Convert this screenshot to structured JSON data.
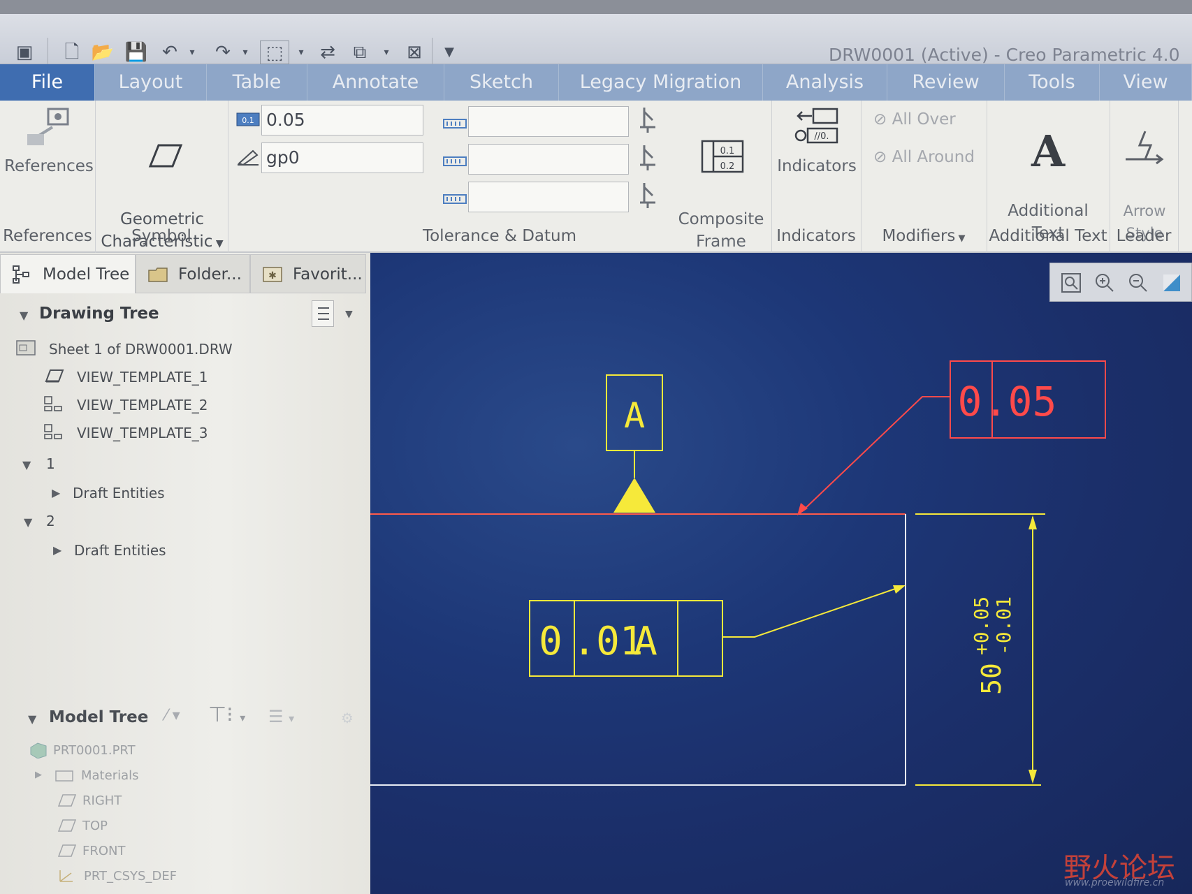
{
  "window": {
    "title": "DRW0001 (Active) - Creo Parametric 4.0"
  },
  "quick_access": {
    "icons": [
      "window-icon",
      "new-icon",
      "open-icon",
      "save-icon",
      "undo-icon",
      "redo-icon",
      "select-box-icon",
      "regenerate-icon",
      "windows-icon",
      "close-icon",
      "customize-icon"
    ]
  },
  "tabs": [
    {
      "label": "File"
    },
    {
      "label": "Layout"
    },
    {
      "label": "Table"
    },
    {
      "label": "Annotate"
    },
    {
      "label": "Sketch"
    },
    {
      "label": "Legacy Migration"
    },
    {
      "label": "Analysis"
    },
    {
      "label": "Review"
    },
    {
      "label": "Tools"
    },
    {
      "label": "View"
    }
  ],
  "ribbon": {
    "references_button": "References",
    "geometric_characteristic": "Geometric\nCharacteristic",
    "tolerance_value": "0.05",
    "name_value": "gp0",
    "datum_fields": [
      "",
      "",
      ""
    ],
    "composite_frame": "Composite\nFrame",
    "indicators_button": "Indicators",
    "all_over": "All Over",
    "all_around": "All Around",
    "additional_text": "Additional\nText",
    "arrow_style": "Arrow\nStyle",
    "groups": {
      "references": "References",
      "symbol": "Symbol",
      "tolerance_datum": "Tolerance & Datum",
      "indicators": "Indicators",
      "modifiers": "Modifiers",
      "additional_text": "Additional Text",
      "leader": "Leader"
    }
  },
  "panel": {
    "tabs": [
      {
        "label": "Model Tree"
      },
      {
        "label": "Folder..."
      },
      {
        "label": "Favorit..."
      }
    ],
    "drawing_tree": {
      "title": "Drawing Tree",
      "rows": [
        "Sheet 1 of DRW0001.DRW",
        "VIEW_TEMPLATE_1",
        "VIEW_TEMPLATE_2",
        "VIEW_TEMPLATE_3",
        "1",
        "Draft Entities",
        "2",
        "Draft Entities"
      ]
    },
    "model_tree": {
      "title": "Model Tree",
      "rows": [
        "PRT0001.PRT",
        "Materials",
        "RIGHT",
        "TOP",
        "FRONT",
        "PRT_CSYS_DEF"
      ]
    }
  },
  "drawing": {
    "datum_label": "A",
    "gtol_selected": {
      "tol_a": "0",
      "tol_b": ".05"
    },
    "gtol_existing": {
      "tol_a": "0",
      "tol_b": ".01",
      "datum": "A"
    },
    "dimension": {
      "nominal": "50",
      "upper": "+0.05",
      "lower": "-0.01"
    },
    "colors": {
      "yellow": "#f6e93a",
      "red": "#ff4a4a",
      "white": "#e8ecf4",
      "background": "#1d3777"
    }
  },
  "watermark": {
    "text": "野火论坛",
    "url": "www.proewildfire.cn"
  }
}
